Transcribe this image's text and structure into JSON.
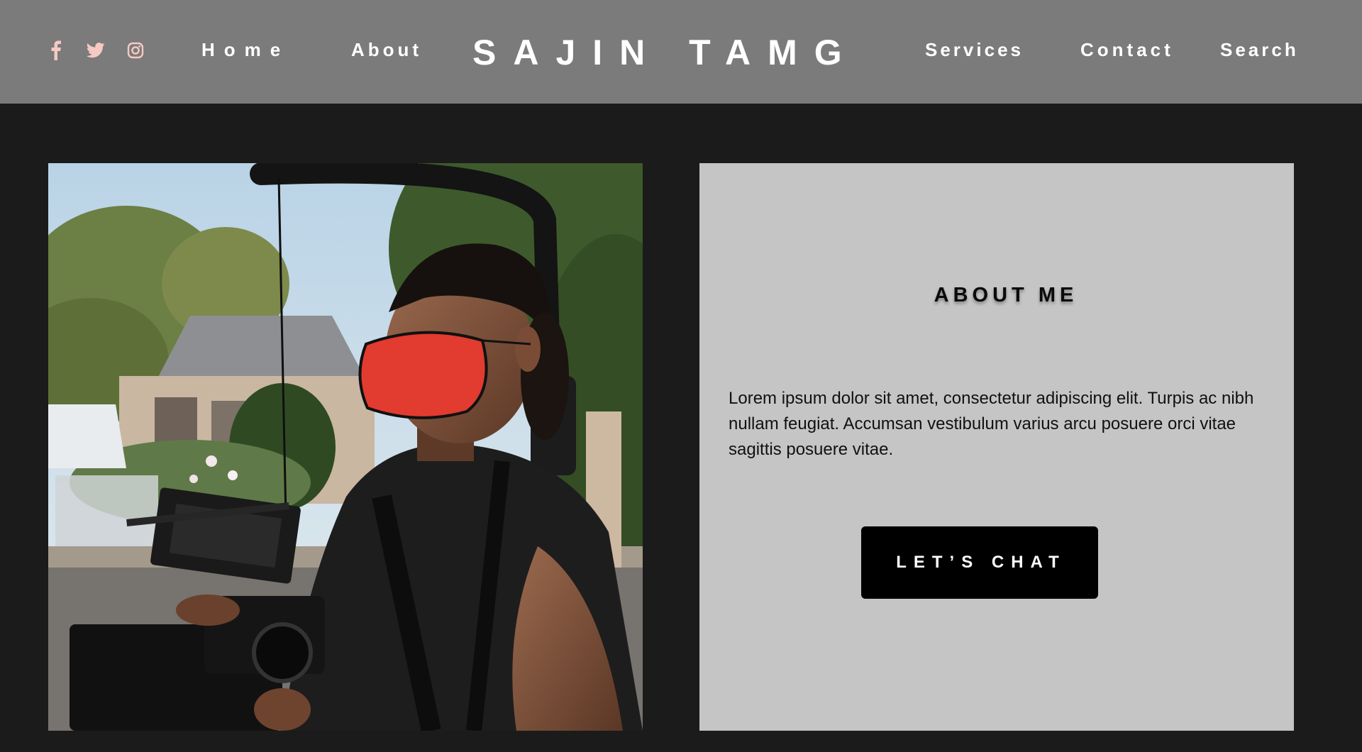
{
  "header": {
    "brand": "SAJIN TAMG",
    "nav": {
      "home": "Home",
      "about": "About",
      "services": "Services",
      "contact": "Contact",
      "search": "Search"
    },
    "social_icons": [
      "facebook-icon",
      "twitter-icon",
      "instagram-icon"
    ],
    "social_icon_color": "#f6c9c4",
    "background": "#7b7b7b"
  },
  "about": {
    "heading": "ABOUT ME",
    "body": "Lorem ipsum dolor sit amet, consectetur adipiscing elit. Turpis ac nibh nullam feugiat. Accumsan vestibulum varius arcu posuere orci vitae sagittis posuere vitae.",
    "button_label": "LET’S CHAT",
    "panel_color": "#c5c5c5"
  },
  "page_background": "#1b1b1b"
}
